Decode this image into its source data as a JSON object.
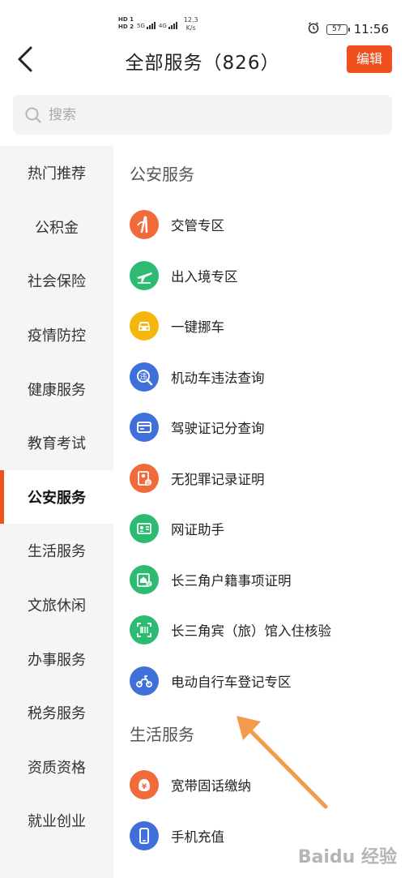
{
  "status_bar": {
    "hd1": "HD 1",
    "hd2": "HD 2",
    "net1": "5G",
    "net2": "4G",
    "speed_value": "12.3",
    "speed_unit": "K/s",
    "battery": "57",
    "time": "11:56"
  },
  "header": {
    "title": "全部服务（826）",
    "edit_label": "编辑"
  },
  "search": {
    "placeholder": "搜索"
  },
  "sidebar": {
    "items": [
      {
        "label": "热门推荐"
      },
      {
        "label": "公积金"
      },
      {
        "label": "社会保险"
      },
      {
        "label": "疫情防控"
      },
      {
        "label": "健康服务"
      },
      {
        "label": "教育考试"
      },
      {
        "label": "公安服务"
      },
      {
        "label": "生活服务"
      },
      {
        "label": "文旅休闲"
      },
      {
        "label": "办事服务"
      },
      {
        "label": "税务服务"
      },
      {
        "label": "资质资格"
      },
      {
        "label": "就业创业"
      }
    ],
    "active_index": 6
  },
  "sections": [
    {
      "title": "公安服务",
      "items": [
        {
          "label": "交管专区",
          "icon": "traffic-road-icon",
          "color": "#f06a3a"
        },
        {
          "label": "出入境专区",
          "icon": "airplane-icon",
          "color": "#2dbb72"
        },
        {
          "label": "一键挪车",
          "icon": "car-icon",
          "color": "#f6b70d"
        },
        {
          "label": "机动车违法查询",
          "icon": "violation-search-icon",
          "color": "#3f6fd8"
        },
        {
          "label": "驾驶证记分查询",
          "icon": "license-card-icon",
          "color": "#3f6fd8"
        },
        {
          "label": "无犯罪记录证明",
          "icon": "certificate-icon",
          "color": "#f06a3a"
        },
        {
          "label": "网证助手",
          "icon": "id-card-icon",
          "color": "#2dbb72"
        },
        {
          "label": "长三角户籍事项证明",
          "icon": "household-certificate-icon",
          "color": "#2dbb72"
        },
        {
          "label": "长三角宾（旅）馆入住核验",
          "icon": "barcode-scan-icon",
          "color": "#2dbb72"
        },
        {
          "label": "电动自行车登记专区",
          "icon": "e-bike-icon",
          "color": "#3f6fd8"
        }
      ]
    },
    {
      "title": "生活服务",
      "items": [
        {
          "label": "宽带固话缴纳",
          "icon": "yuan-payment-icon",
          "color": "#f06a3a"
        },
        {
          "label": "手机充值",
          "icon": "mobile-phone-icon",
          "color": "#3f6fd8"
        }
      ]
    }
  ],
  "accent_color": "#f0501e",
  "annotation_arrow_color": "#f39a4c",
  "watermark": "Baidu 经验"
}
